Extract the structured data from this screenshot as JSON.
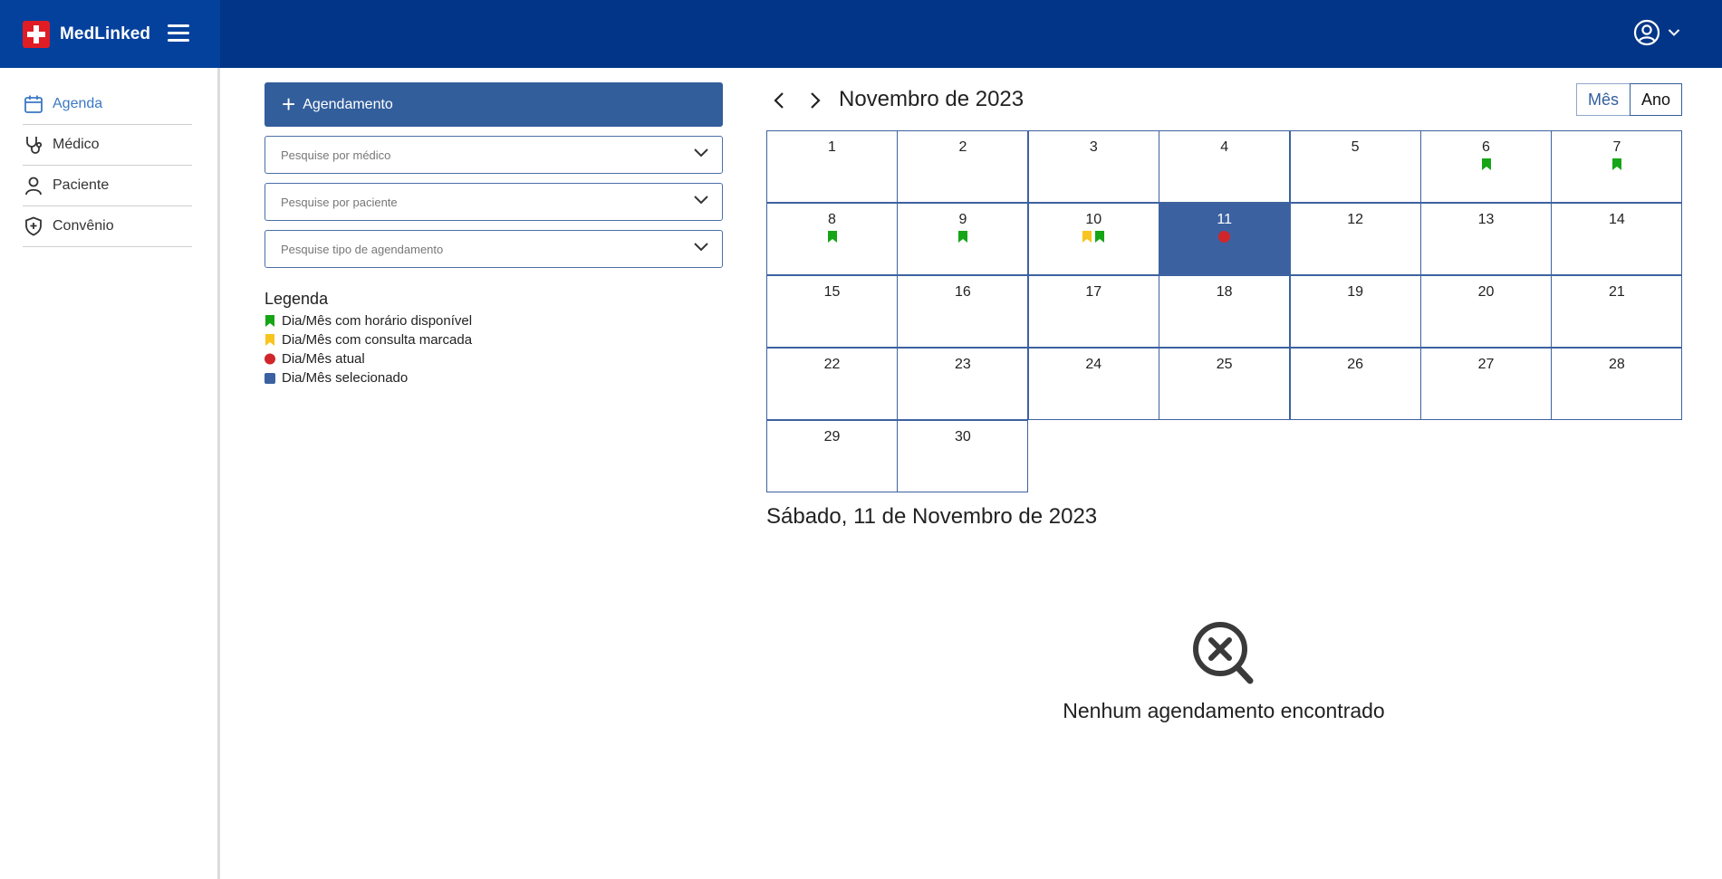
{
  "app": {
    "name": "MedLinked"
  },
  "header": {
    "menu_icon": "hamburger-icon",
    "user_icon": "user-circle-icon"
  },
  "sidebar": {
    "items": [
      {
        "label": "Agenda",
        "icon": "calendar-icon",
        "active": true
      },
      {
        "label": "Médico",
        "icon": "stethoscope-icon",
        "active": false
      },
      {
        "label": "Paciente",
        "icon": "user-icon",
        "active": false
      },
      {
        "label": "Convênio",
        "icon": "shield-plus-icon",
        "active": false
      }
    ]
  },
  "panel": {
    "add_button": "Agendamento",
    "filters": [
      {
        "placeholder": "Pesquise por médico"
      },
      {
        "placeholder": "Pesquise por paciente"
      },
      {
        "placeholder": "Pesquise tipo de agendamento"
      }
    ],
    "legend": {
      "title": "Legenda",
      "items": [
        {
          "label": "Dia/Mês com horário disponível",
          "marker": "green-bookmark"
        },
        {
          "label": "Dia/Mês com consulta marcada",
          "marker": "yellow-bookmark"
        },
        {
          "label": "Dia/Mês atual",
          "marker": "red-dot"
        },
        {
          "label": "Dia/Mês selecionado",
          "marker": "blue-square"
        }
      ]
    }
  },
  "calendar": {
    "title": "Novembro de 2023",
    "views": [
      "Mês",
      "Ano"
    ],
    "active_view": "Mês",
    "days": [
      {
        "d": "1",
        "m": []
      },
      {
        "d": "2",
        "m": []
      },
      {
        "d": "3",
        "m": []
      },
      {
        "d": "4",
        "m": []
      },
      {
        "d": "5",
        "m": []
      },
      {
        "d": "6",
        "m": [
          "green"
        ]
      },
      {
        "d": "7",
        "m": [
          "green"
        ]
      },
      {
        "d": "8",
        "m": [
          "green"
        ]
      },
      {
        "d": "9",
        "m": [
          "green"
        ]
      },
      {
        "d": "10",
        "m": [
          "yellow",
          "green"
        ]
      },
      {
        "d": "11",
        "m": [
          "red"
        ],
        "selected": true
      },
      {
        "d": "12",
        "m": []
      },
      {
        "d": "13",
        "m": []
      },
      {
        "d": "14",
        "m": []
      },
      {
        "d": "15",
        "m": []
      },
      {
        "d": "16",
        "m": []
      },
      {
        "d": "17",
        "m": []
      },
      {
        "d": "18",
        "m": []
      },
      {
        "d": "19",
        "m": []
      },
      {
        "d": "20",
        "m": []
      },
      {
        "d": "21",
        "m": []
      },
      {
        "d": "22",
        "m": []
      },
      {
        "d": "23",
        "m": []
      },
      {
        "d": "24",
        "m": []
      },
      {
        "d": "25",
        "m": []
      },
      {
        "d": "26",
        "m": []
      },
      {
        "d": "27",
        "m": []
      },
      {
        "d": "28",
        "m": []
      },
      {
        "d": "29",
        "m": []
      },
      {
        "d": "30",
        "m": []
      }
    ]
  },
  "day_detail": {
    "title": "Sábado, 11 de Novembro de 2023",
    "empty_message": "Nenhum agendamento encontrado",
    "empty_icon": "search-x-icon"
  },
  "colors": {
    "header": "#023587",
    "brand_bg": "#04419c",
    "primary": "#335e9c",
    "available": "#16a516",
    "booked": "#f7c51e",
    "today": "#d0262b",
    "selected": "#3b61a0"
  }
}
